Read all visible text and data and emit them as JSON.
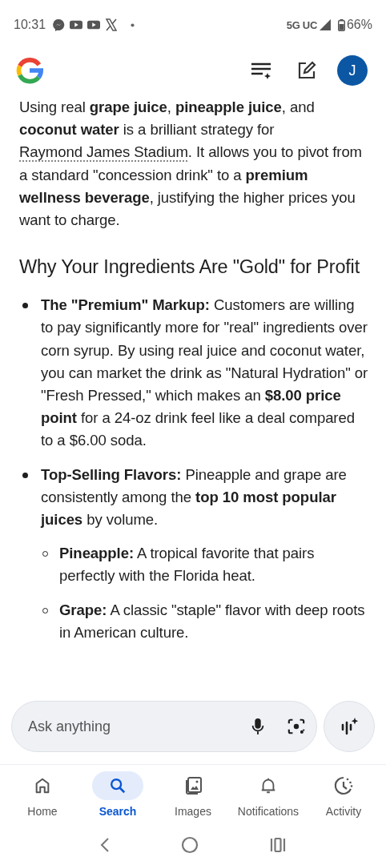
{
  "status_bar": {
    "time": "10:31",
    "network": "5G UC",
    "battery": "66%"
  },
  "header": {
    "avatar_letter": "J"
  },
  "intro": {
    "before": "Using real **grape juice**, **pineapple juice**, and **coconut water** is a brilliant strategy for",
    "link": "Raymond James Stadium",
    "after": ". It allows you to pivot from a standard \"concession drink\" to a **premium wellness beverage**, justifying the higher prices you want to charge."
  },
  "heading": "Why Your Ingredients Are \"Gold\" for Profit",
  "bullets": [
    {
      "label": "The \"Premium\" Markup:",
      "text": "Customers are willing to pay significantly more for \"real\" ingredients over corn syrup. By using real juice and coconut water, you can market the drink as \"Natural Hydration\" or \"Fresh Pressed,\" which makes an **$8.00 price point** for a 24-oz drink feel like a deal compared to a $6.00 soda."
    },
    {
      "label": "Top-Selling Flavors:",
      "text": "Pineapple and grape are consistently among the **top 10 most popular juices** by volume.",
      "children": [
        {
          "label": "Pineapple:",
          "text": "A tropical favorite that pairs perfectly with the Florida heat."
        },
        {
          "label": "Grape:",
          "text": "A classic \"staple\" flavor with deep roots in American culture."
        }
      ]
    }
  ],
  "search": {
    "placeholder": "Ask anything"
  },
  "nav": [
    {
      "label": "Home",
      "selected": false
    },
    {
      "label": "Search",
      "selected": true
    },
    {
      "label": "Images",
      "selected": false
    },
    {
      "label": "Notifications",
      "selected": false
    },
    {
      "label": "Activity",
      "selected": false
    }
  ]
}
